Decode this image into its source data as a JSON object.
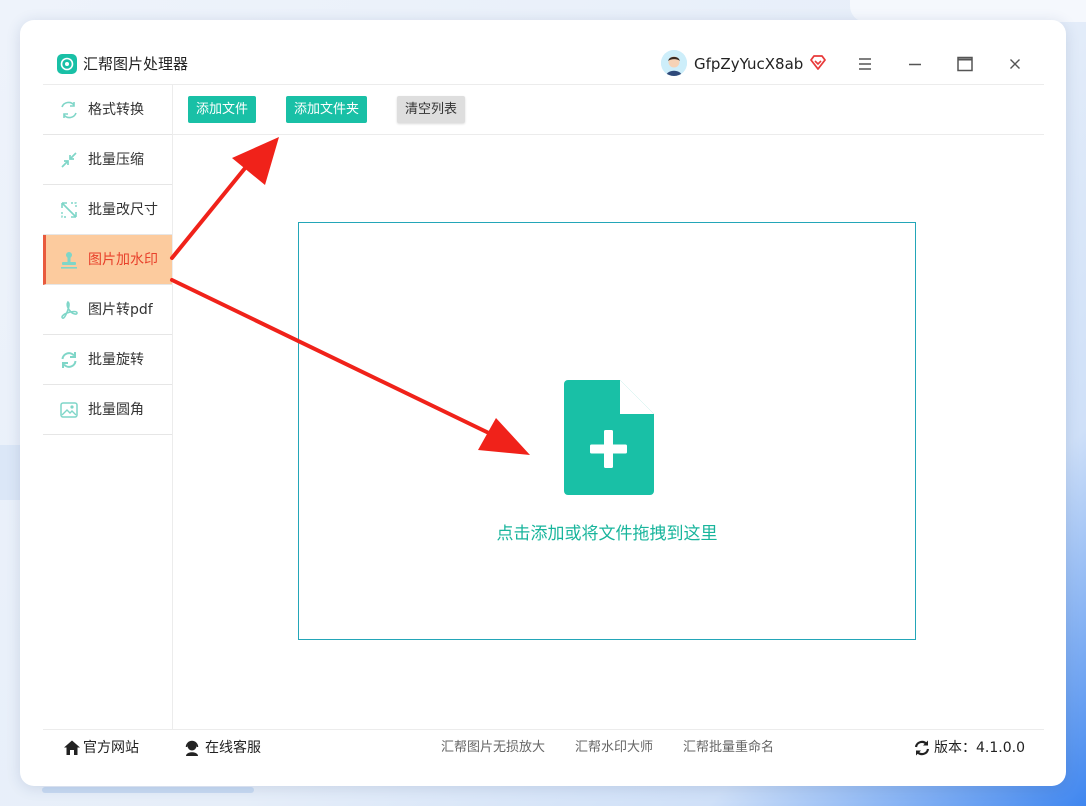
{
  "app": {
    "title": "汇帮图片处理器"
  },
  "user": {
    "name": "GfpZyYucX8ab"
  },
  "sidebar": {
    "items": [
      {
        "label": "格式转换",
        "icon": "format-convert-icon"
      },
      {
        "label": "批量压缩",
        "icon": "compress-icon"
      },
      {
        "label": "批量改尺寸",
        "icon": "resize-icon"
      },
      {
        "label": "图片加水印",
        "icon": "watermark-stamp-icon",
        "active": true
      },
      {
        "label": "图片转pdf",
        "icon": "pdf-icon"
      },
      {
        "label": "批量旋转",
        "icon": "rotate-icon"
      },
      {
        "label": "批量圆角",
        "icon": "rounded-corner-image-icon"
      }
    ]
  },
  "toolbar": {
    "add_file": "添加文件",
    "add_folder": "添加文件夹",
    "clear_list": "清空列表"
  },
  "dropzone": {
    "text": "点击添加或将文件拖拽到这里"
  },
  "footer": {
    "official_site": "官方网站",
    "online_service": "在线客服",
    "link1": "汇帮图片无损放大",
    "link2": "汇帮水印大师",
    "link3": "汇帮批量重命名",
    "version": "版本：4.1.0.0"
  },
  "colors": {
    "accent": "#19c0a6",
    "active_bg": "#fccb9e",
    "active_text": "#e8412b",
    "annotation_arrow": "#f0221a"
  }
}
